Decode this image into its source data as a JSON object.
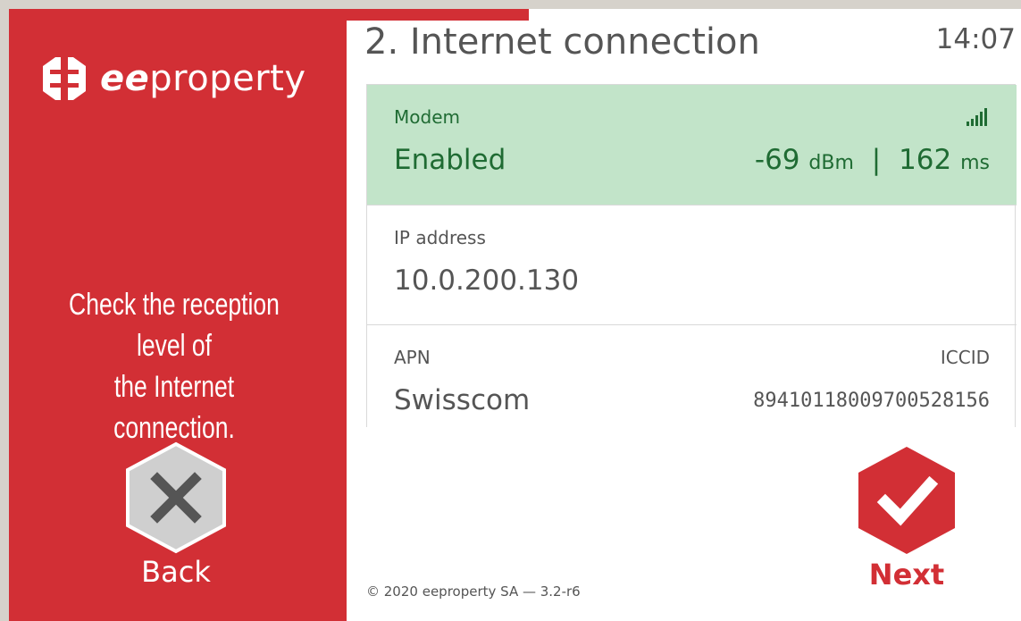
{
  "brand": {
    "name_bold": "ee",
    "name_rest": "property",
    "color": "#d22f35"
  },
  "sidebar": {
    "instruction_line1": "Check the reception level of",
    "instruction_line2": "the Internet connection.",
    "back_label": "Back",
    "back_icon": "close-x-icon"
  },
  "header": {
    "title": "2. Internet connection",
    "time": "14:07"
  },
  "progress": {
    "fraction": 0.27
  },
  "status": {
    "modem_label": "Modem",
    "modem_value": "Enabled",
    "signal_dbm": "-69",
    "signal_unit": "dBm",
    "separator": "|",
    "latency": "162",
    "latency_unit": "ms",
    "signal_icon": "signal-bars-icon",
    "ok_background": "#c2e4c9",
    "ok_text_color": "#1f6b33",
    "ip_label": "IP address",
    "ip_value": "10.0.200.130",
    "apn_label": "APN",
    "apn_value": "Swisscom",
    "iccid_label": "ICCID",
    "iccid_value": "89410118009700528156"
  },
  "actions": {
    "next_label": "Next",
    "next_icon": "checkmark-icon"
  },
  "footer": {
    "copyright": "© 2020 eeproperty SA — 3.2-r6"
  }
}
